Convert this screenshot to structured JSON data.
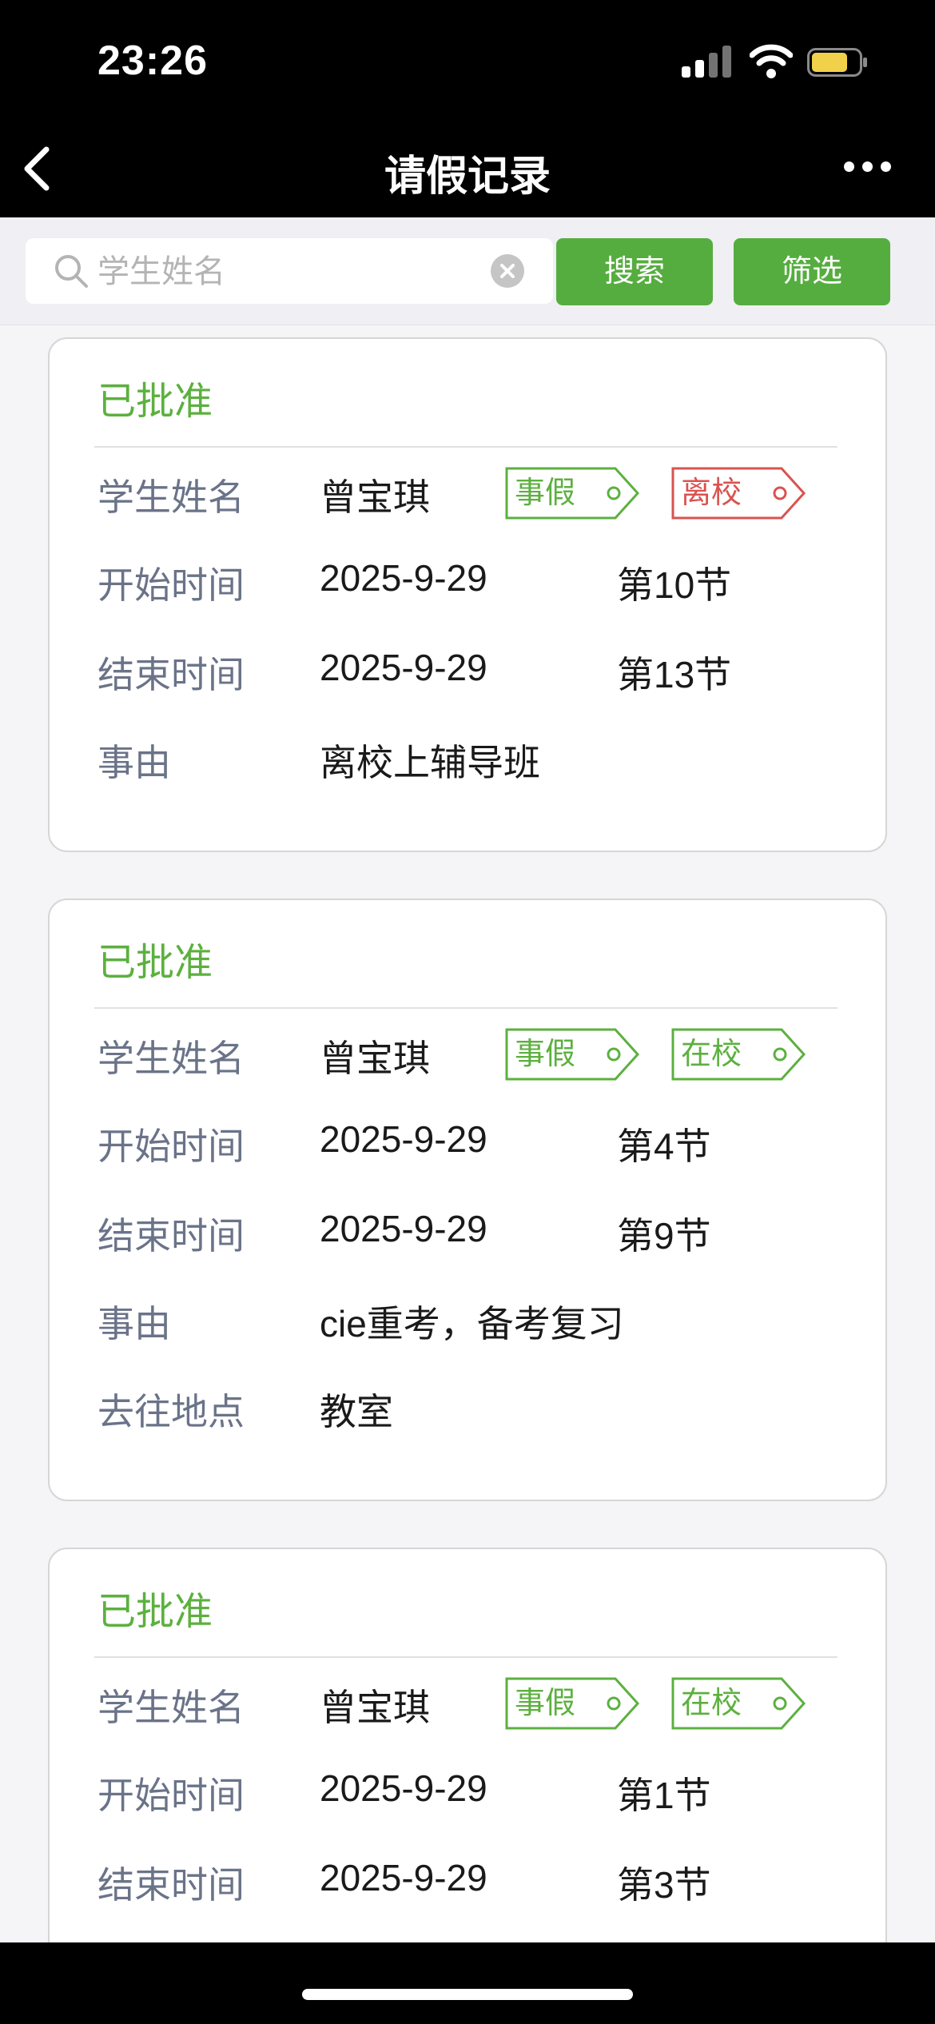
{
  "status_bar": {
    "time": "23:26"
  },
  "nav": {
    "title": "请假记录"
  },
  "search": {
    "placeholder": "学生姓名",
    "search_label": "搜索",
    "filter_label": "筛选"
  },
  "colors": {
    "accent": "#56ad3f",
    "status_green": "#5cb03f",
    "tag_red": "#d9534f"
  },
  "cards": [
    {
      "status": "已批准",
      "name_label": "学生姓名",
      "name": "曾宝琪",
      "tags": [
        {
          "text": "事假",
          "color": "green"
        },
        {
          "text": "离校",
          "color": "red"
        }
      ],
      "start_label": "开始时间",
      "start_date": "2025-9-29",
      "start_period": "第10节",
      "end_label": "结束时间",
      "end_date": "2025-9-29",
      "end_period": "第13节",
      "reason_label": "事由",
      "reason": "离校上辅导班"
    },
    {
      "status": "已批准",
      "name_label": "学生姓名",
      "name": "曾宝琪",
      "tags": [
        {
          "text": "事假",
          "color": "green"
        },
        {
          "text": "在校",
          "color": "green"
        }
      ],
      "start_label": "开始时间",
      "start_date": "2025-9-29",
      "start_period": "第4节",
      "end_label": "结束时间",
      "end_date": "2025-9-29",
      "end_period": "第9节",
      "reason_label": "事由",
      "reason": "cie重考，备考复习",
      "location_label": "去往地点",
      "location": "教室"
    },
    {
      "status": "已批准",
      "name_label": "学生姓名",
      "name": "曾宝琪",
      "tags": [
        {
          "text": "事假",
          "color": "green"
        },
        {
          "text": "在校",
          "color": "green"
        }
      ],
      "start_label": "开始时间",
      "start_date": "2025-9-29",
      "start_period": "第1节",
      "end_label": "结束时间",
      "end_date": "2025-9-29",
      "end_period": "第3节"
    }
  ]
}
